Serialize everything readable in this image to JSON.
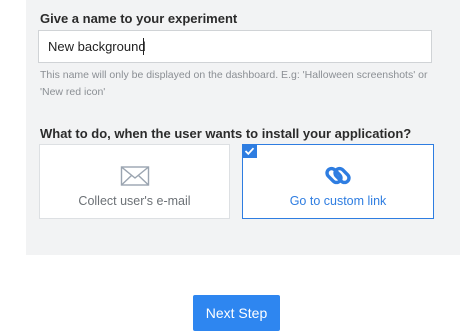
{
  "form": {
    "name_label": "Give a name to your experiment",
    "name_value": "New background",
    "name_help_line1": "This name will only be displayed on the dashboard. E.g: 'Halloween screenshots' or",
    "name_help_line2": "'New red icon'",
    "action_label": "What to do, when the user wants to install your application?",
    "options": [
      {
        "label": "Collect user's e-mail",
        "icon": "envelope-icon",
        "selected": false
      },
      {
        "label": "Go to custom link",
        "icon": "link-icon",
        "selected": true
      }
    ]
  },
  "footer": {
    "next_label": "Next Step"
  },
  "colors": {
    "accent": "#2e7de1",
    "button": "#2e86f0",
    "panel_bg": "#f2f3f4",
    "muted_text": "#8b8f94"
  }
}
